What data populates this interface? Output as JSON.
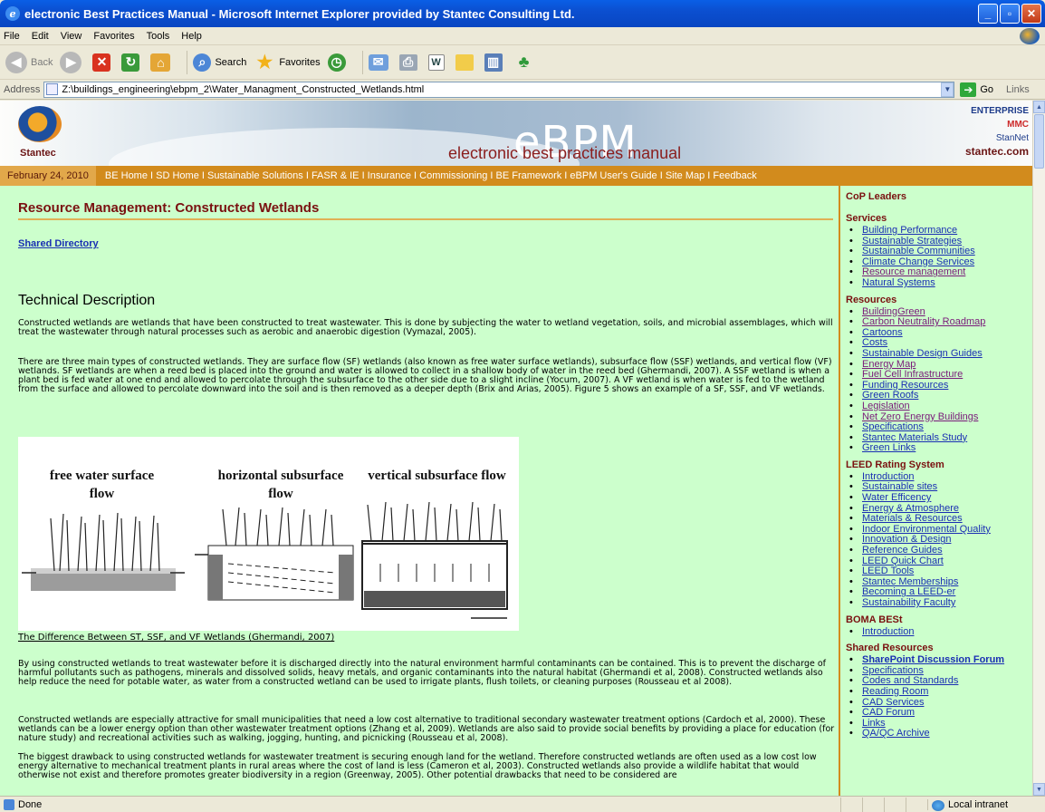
{
  "window": {
    "title": "electronic Best Practices Manual - Microsoft Internet Explorer provided by Stantec Consulting Ltd."
  },
  "menu": [
    "File",
    "Edit",
    "View",
    "Favorites",
    "Tools",
    "Help"
  ],
  "toolbar": {
    "back": "Back",
    "search": "Search",
    "favorites": "Favorites"
  },
  "address": {
    "label": "Address",
    "url": "Z:\\buildings_engineering\\ebpm_2\\Water_Managment_Constructed_Wetlands.html",
    "go": "Go",
    "links": "Links"
  },
  "banner": {
    "brand": "Stantec",
    "ebpm": "eBPM",
    "subtitle": "electronic best practices manual",
    "partners": [
      "ENTERPRISE",
      "MMC",
      "StanNet",
      "stantec.com"
    ]
  },
  "nav": {
    "date": "February 24, 2010",
    "links": "BE Home I SD Home I Sustainable Solutions I FASR & IE I Insurance I Commissioning I BE Framework I eBPM User's Guide I  Site Map I Feedback"
  },
  "main": {
    "heading": "Resource Management: Constructed Wetlands",
    "shared_link": "Shared Directory",
    "section_title": "Technical Description",
    "p1": "Constructed wetlands are wetlands that have been constructed to treat wastewater. This is done by subjecting the water to wetland vegetation, soils, and microbial assemblages, which will treat the wastewater through natural processes such as aerobic and anaerobic digestion (Vymazal, 2005).",
    "p2": "There are three main types of constructed wetlands. They are surface flow (SF) wetlands (also known as free water surface wetlands), subsurface flow (SSF) wetlands, and vertical flow (VF) wetlands. SF wetlands are when a reed bed is placed into the ground and water is allowed to collect in a shallow body of water in the reed bed (Ghermandi, 2007). A SSF wetland is when a plant bed is fed water at one end and allowed to percolate through the subsurface to the other side due to a slight incline (Yocum, 2007). A VF wetland is when water is fed to the wetland from the surface and allowed to percolate downward into the soil and is then removed as a deeper depth (Brix and Arias, 2005). Figure 5 shows an example of a SF, SSF, and VF wetlands.",
    "figure_labels": [
      "free water surface flow",
      "horizontal subsurface flow",
      "vertical subsurface flow"
    ],
    "figure_caption": "The Difference Between ST, SSF, and VF Wetlands (Ghermandi, 2007)",
    "p3": "By using constructed wetlands to treat wastewater before it is discharged directly into the natural environment harmful contaminants can be contained. This is to prevent the discharge of harmful pollutants such as pathogens, minerals and dissolved solids, heavy metals, and organic contaminants into the natural habitat (Ghermandi et al, 2008). Constructed wetlands also help reduce the need for potable water, as water from a constructed wetland can be used to irrigate plants, flush toilets, or cleaning purposes (Rousseau et al 2008).",
    "p4": "Constructed wetlands are especially attractive for small municipalities that need a low cost alternative to traditional secondary wastewater treatment options (Cardoch et al, 2000). These wetlands can be a lower energy option than other wastewater treatment options (Zhang et al, 2009). Wetlands are also said to provide social benefits by providing a place for education (for nature study) and recreational activities such as walking, jogging, hunting, and picnicking (Rousseau et al, 2008).",
    "p5": "The biggest drawback to using constructed wetlands for wastewater treatment is securing enough land for the wetland. Therefore constructed wetlands are often used as a low cost low energy alternative to mechanical treatment plants in rural areas where the cost of land is less (Cameron et al, 2003). Constructed wetlands also provide a wildlife habitat that would otherwise not exist and therefore promotes greater biodiversity in a region (Greenway, 2005). Other potential drawbacks that need to be considered are"
  },
  "sidebar": {
    "cop": "CoP Leaders",
    "services_title": "Services",
    "services": [
      "Building Performance",
      "Sustainable Strategies",
      "Sustainable Communities",
      "Climate Change Services",
      "Resource management",
      "Natural Systems"
    ],
    "resources_title": "Resources",
    "resources": [
      "BuildingGreen",
      "Carbon Neutrality Roadmap",
      "Cartoons",
      "Costs",
      "Sustainable Design Guides",
      "Energy Map",
      "Fuel Cell Infrastructure",
      "Funding Resources",
      "Green Roofs",
      "Legislation",
      "Net Zero Energy Buildings",
      "Specifications",
      "Stantec Materials Study",
      "Green Links"
    ],
    "leed_title": "LEED Rating System",
    "leed": [
      "Introduction",
      "Sustainable sites",
      "Water Efficency",
      "Energy & Atmosphere",
      "Materials & Resources",
      "Indoor Environmental Quality",
      "Innovation & Design",
      "Reference Guides",
      "LEED Quick Chart",
      "LEED Tools",
      "Stantec Memberships",
      "Becoming a LEED-er",
      "Sustainability Faculty"
    ],
    "boma_title": "BOMA BESt",
    "boma": [
      "Introduction"
    ],
    "shared_title": "Shared Resources",
    "shared": [
      "SharePoint Discussion Forum",
      "Specifications",
      "Codes and Standards",
      "Reading Room",
      "CAD Services",
      "CAD Forum",
      "Links",
      "QA/QC Archive"
    ]
  },
  "status": {
    "left": "Done",
    "zone": "Local intranet"
  }
}
